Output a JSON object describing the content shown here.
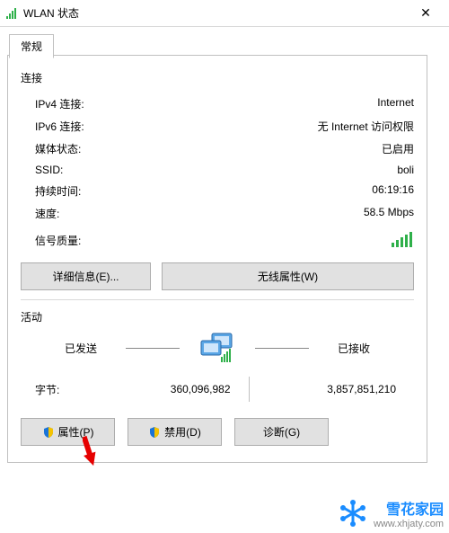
{
  "window": {
    "title": "WLAN 状态",
    "tab": "常规"
  },
  "connection": {
    "section": "连接",
    "ipv4_label": "IPv4 连接:",
    "ipv4_value": "Internet",
    "ipv6_label": "IPv6 连接:",
    "ipv6_value": "无 Internet 访问权限",
    "media_label": "媒体状态:",
    "media_value": "已启用",
    "ssid_label": "SSID:",
    "ssid_value": "boli",
    "duration_label": "持续时间:",
    "duration_value": "06:19:16",
    "speed_label": "速度:",
    "speed_value": "58.5 Mbps",
    "signal_label": "信号质量:"
  },
  "buttons": {
    "details": "详细信息(E)...",
    "wireless": "无线属性(W)",
    "properties": "属性(P)",
    "disable": "禁用(D)",
    "diagnose": "诊断(G)"
  },
  "activity": {
    "section": "活动",
    "sent": "已发送",
    "received": "已接收",
    "bytes_label": "字节:",
    "bytes_sent": "360,096,982",
    "bytes_received": "3,857,851,210"
  },
  "watermark": {
    "name": "雪花家园",
    "url": "www.xhjaty.com"
  },
  "colors": {
    "signal_green": "#2fb04a",
    "shield_blue": "#1a74d8",
    "shield_yellow": "#f6c300"
  }
}
